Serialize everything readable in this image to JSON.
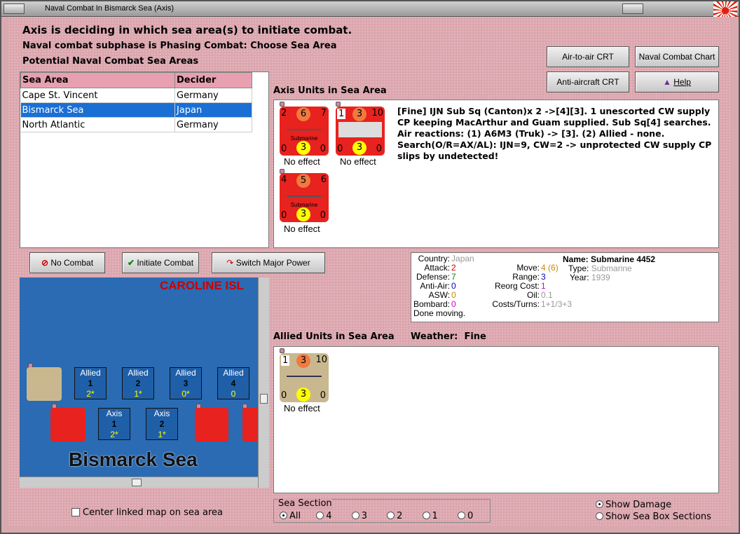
{
  "window": {
    "title": "Naval Combat In Bismarck Sea (Axis)"
  },
  "header": {
    "title": "Axis is deciding in which sea area(s) to initiate combat.",
    "subphase": "Naval combat subphase is Phasing Combat: Choose Sea Area",
    "potential": "Potential Naval Combat Sea Areas"
  },
  "sea_table": {
    "headers": [
      "Sea Area",
      "Decider"
    ],
    "rows": [
      [
        "Cape St. Vincent",
        "Germany"
      ],
      [
        "Bismarck Sea",
        "Japan"
      ],
      [
        "North Atlantic",
        "Germany"
      ]
    ],
    "selected_index": 1
  },
  "buttons": {
    "air_crt": "Air-to-air CRT",
    "naval_chart": "Naval Combat Chart",
    "aa_crt": "Anti-aircraft CRT",
    "help": "Help",
    "no_combat": "No Combat",
    "initiate": "Initiate Combat",
    "switch": "Switch Major Power"
  },
  "axis_units": {
    "title": "Axis Units in Sea Area",
    "counters": [
      {
        "tl": "2",
        "mid": "6",
        "tr": "7",
        "label": "Submarine",
        "bl": "0",
        "bm": "3",
        "br": "0",
        "effect": "No effect"
      },
      {
        "tl": "1",
        "mid": "3",
        "tr": "10",
        "label": "",
        "bl": "0",
        "bm": "3",
        "br": "0",
        "effect": "No effect"
      },
      {
        "tl": "4",
        "mid": "5",
        "tr": "6",
        "label": "Submarine",
        "bl": "0",
        "bm": "3",
        "br": "0",
        "effect": "No effect"
      }
    ]
  },
  "combat_log": "[Fine] IJN Sub Sq (Canton)x 2 ->[4][3]. 1 unescorted CW supply CP keeping MacArthur and Guam supplied. Sub Sq[4] searches. Air reactions: (1) A6M3 (Truk) -> [3]. (2) Allied - none. Search(O/R=AX/AL): IJN=9, CW=2 -> unprotected CW supply CP slips by undetected!",
  "unit_info": {
    "country_label": "Country:",
    "country": "Japan",
    "attack_label": "Attack:",
    "attack": "2",
    "defense_label": "Defense:",
    "defense": "7",
    "aa_label": "Anti-Air:",
    "aa": "0",
    "asw_label": "ASW:",
    "asw": "0",
    "bombard_label": "Bombard:",
    "bombard": "0",
    "status": "Done moving.",
    "name_label": "Name:",
    "name": "Submarine 4452",
    "move_label": "Move:",
    "move": "4",
    "move_paren": "(6)",
    "type_label": "Type:",
    "type": "Submarine",
    "range_label": "Range:",
    "range": "3",
    "year_label": "Year:",
    "year": "1939",
    "reorg_label": "Reorg Cost:",
    "reorg": "1",
    "oil_label": "Oil:",
    "oil": "0.1",
    "costs_label": "Costs/Turns:",
    "costs": "1+1/3+3"
  },
  "map": {
    "region_label": "CAROLINE ISL",
    "sea_name": "Bismarck Sea",
    "allied_boxes": [
      {
        "side": "Allied",
        "num": "1",
        "val": "2*"
      },
      {
        "side": "Allied",
        "num": "2",
        "val": "1*"
      },
      {
        "side": "Allied",
        "num": "3",
        "val": "0*"
      },
      {
        "side": "Allied",
        "num": "4",
        "val": "0"
      }
    ],
    "axis_boxes": [
      {
        "side": "Axis",
        "num": "1",
        "val": "2*"
      },
      {
        "side": "Axis",
        "num": "2",
        "val": "1*"
      }
    ]
  },
  "allied_units": {
    "title": "Allied Units in Sea Area",
    "weather_label": "Weather:",
    "weather": "Fine",
    "counter": {
      "tl": "1",
      "mid": "3",
      "tr": "10",
      "bl": "0",
      "bm": "3",
      "br": "0",
      "effect": "No effect"
    }
  },
  "center_map": {
    "label": "Center linked map on sea area",
    "checked": false
  },
  "sea_section": {
    "label": "Sea Section",
    "options": [
      "All",
      "4",
      "3",
      "2",
      "1",
      "0"
    ],
    "selected": "All"
  },
  "display": {
    "show_damage": "Show Damage",
    "show_sections": "Show Sea Box Sections",
    "selected": "Show Damage"
  },
  "colors": {
    "red_counter": "#e8221e",
    "tan_counter": "#c9b88f",
    "selection": "#1a6fd4",
    "sea": "#2a6bb3"
  }
}
